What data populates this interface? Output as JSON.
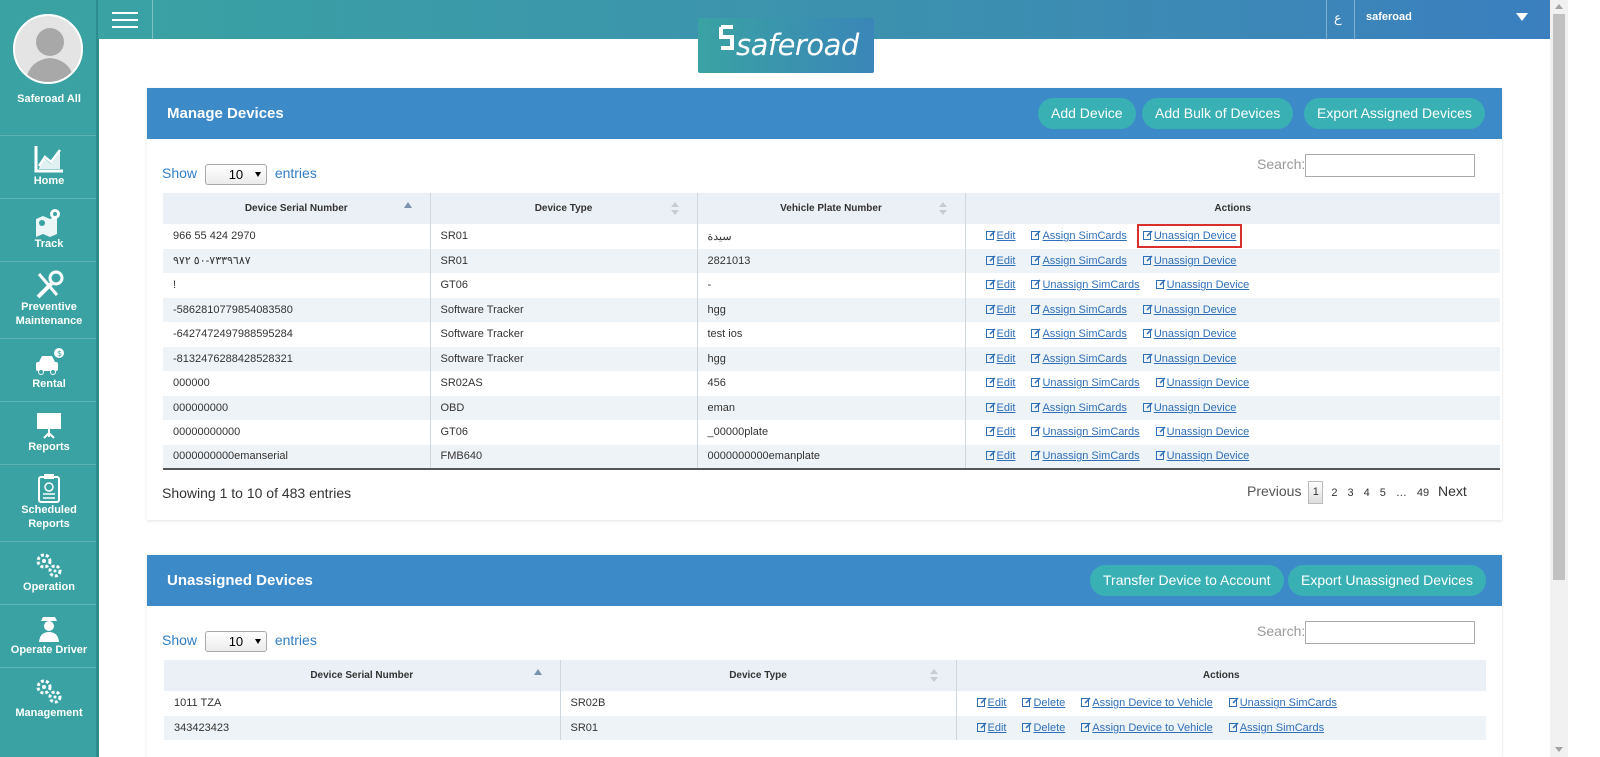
{
  "sidebar": {
    "user_name": "Saferoad All",
    "items": [
      {
        "label": "Home"
      },
      {
        "label": "Track"
      },
      {
        "label": "Preventive Maintenance"
      },
      {
        "label": "Rental"
      },
      {
        "label": "Reports"
      },
      {
        "label": "Scheduled Reports"
      },
      {
        "label": "Operation"
      },
      {
        "label": "Operate Driver"
      },
      {
        "label": "Management"
      }
    ]
  },
  "topbar": {
    "lang_toggle": "ع",
    "user_menu": "saferoad"
  },
  "logo": {
    "text": "saferoad"
  },
  "manage_devices": {
    "title": "Manage Devices",
    "buttons": {
      "add_device": "Add Device",
      "add_bulk": "Add Bulk of Devices",
      "export_assigned": "Export Assigned Devices"
    },
    "show_label": "Show",
    "entries_label": "entries",
    "page_size": "10",
    "search_label": "Search:",
    "columns": [
      "Device Serial Number",
      "Device Type",
      "Vehicle Plate Number",
      "Actions"
    ],
    "rows": [
      {
        "serial": "966 55 424 2970",
        "type": "SR01",
        "plate": "سيدة",
        "actions": [
          "Edit",
          "Assign SimCards",
          "Unassign Device"
        ]
      },
      {
        "serial": "٧٣٣٩٦٨٧-٥٠ ٩٧٢",
        "type": "SR01",
        "plate": "2821013",
        "actions": [
          "Edit",
          "Assign SimCards",
          "Unassign Device"
        ]
      },
      {
        "serial": "!",
        "type": "GT06",
        "plate": "-",
        "actions": [
          "Edit",
          "Unassign SimCards",
          "Unassign Device"
        ]
      },
      {
        "serial": "-5862810779854083580",
        "type": "Software Tracker",
        "plate": "hgg",
        "actions": [
          "Edit",
          "Assign SimCards",
          "Unassign Device"
        ]
      },
      {
        "serial": "-6427472497988595284",
        "type": "Software Tracker",
        "plate": "test ios",
        "actions": [
          "Edit",
          "Assign SimCards",
          "Unassign Device"
        ]
      },
      {
        "serial": "-8132476288428528321",
        "type": "Software Tracker",
        "plate": "hgg",
        "actions": [
          "Edit",
          "Assign SimCards",
          "Unassign Device"
        ]
      },
      {
        "serial": "000000",
        "type": "SR02AS",
        "plate": "456",
        "actions": [
          "Edit",
          "Unassign SimCards",
          "Unassign Device"
        ]
      },
      {
        "serial": "000000000",
        "type": "OBD",
        "plate": "eman",
        "actions": [
          "Edit",
          "Assign SimCards",
          "Unassign Device"
        ]
      },
      {
        "serial": "00000000000",
        "type": "GT06",
        "plate": "_00000plate",
        "actions": [
          "Edit",
          "Unassign SimCards",
          "Unassign Device"
        ]
      },
      {
        "serial": "0000000000emanserial",
        "type": "FMB640",
        "plate": "0000000000emanplate",
        "actions": [
          "Edit",
          "Unassign SimCards",
          "Unassign Device"
        ]
      }
    ],
    "info": "Showing 1 to 10 of 483 entries",
    "pagination": {
      "previous": "Previous",
      "pages": [
        "1",
        "2",
        "3",
        "4",
        "5",
        "…",
        "49"
      ],
      "current": "1",
      "next": "Next"
    }
  },
  "unassigned_devices": {
    "title": "Unassigned Devices",
    "buttons": {
      "transfer": "Transfer Device to Account",
      "export_unassigned": "Export Unassigned Devices"
    },
    "show_label": "Show",
    "entries_label": "entries",
    "page_size": "10",
    "search_label": "Search:",
    "columns": [
      "Device Serial Number",
      "Device Type",
      "Actions"
    ],
    "rows": [
      {
        "serial": "1011 TZA",
        "type": "SR02B",
        "actions": [
          "Edit",
          "Delete",
          "Assign Device to Vehicle",
          "Unassign SimCards"
        ]
      },
      {
        "serial": "343423423",
        "type": "SR01",
        "actions": [
          "Edit",
          "Delete",
          "Assign Device to Vehicle",
          "Assign SimCards"
        ]
      }
    ]
  },
  "colors": {
    "sidebar": "#3aa2a3",
    "panel_header": "#3d8ac9",
    "pill_button": "#39b0b3",
    "link": "#2f6fb7",
    "highlight": "#d9302c"
  }
}
